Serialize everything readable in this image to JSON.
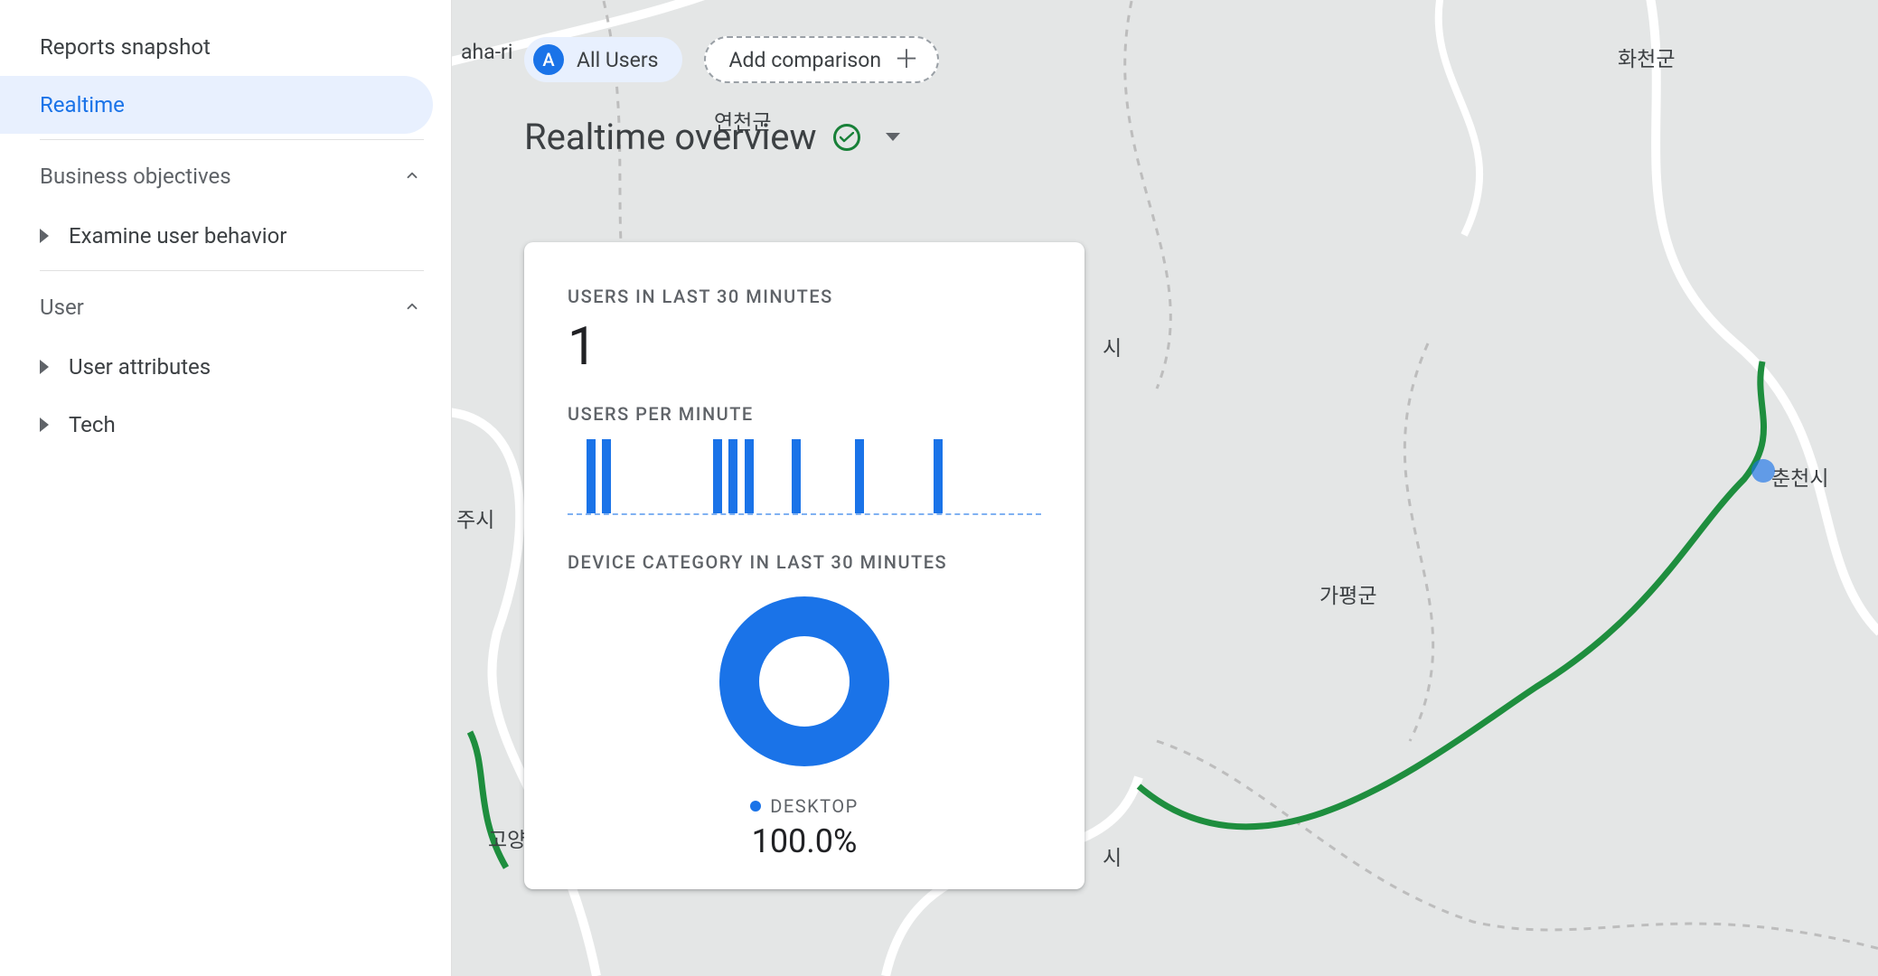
{
  "sidebar": {
    "reports_snapshot": "Reports snapshot",
    "realtime": "Realtime",
    "business_objectives": "Business objectives",
    "examine_user_behavior": "Examine user behavior",
    "user": "User",
    "user_attributes": "User attributes",
    "tech": "Tech"
  },
  "topbar": {
    "chip_letter": "A",
    "chip_label": "All Users",
    "add_comparison": "Add comparison"
  },
  "title": "Realtime overview",
  "map": {
    "labels": {
      "aha_ri": "aha-ri",
      "yeoncheon": "연천군",
      "si1": "시",
      "jusi": "주시",
      "goyang": "고양",
      "si2": "시",
      "gapyeong": "가평군",
      "hwacheon": "화천군",
      "chuncheon": "춘천시"
    }
  },
  "card": {
    "users_title": "USERS IN LAST 30 MINUTES",
    "users_value": "1",
    "upm_title": "USERS PER MINUTE",
    "device_title": "DEVICE CATEGORY IN LAST 30 MINUTES",
    "legend_label": "DESKTOP",
    "legend_pct": "100.0%"
  },
  "chart_data": {
    "type": "bar",
    "series_name": "Users per minute",
    "x_range_minutes": 30,
    "ylim": [
      0,
      1
    ],
    "values": [
      0,
      1,
      1,
      0,
      0,
      0,
      0,
      0,
      0,
      1,
      1,
      1,
      0,
      0,
      1,
      0,
      0,
      0,
      1,
      0,
      0,
      0,
      0,
      1,
      0,
      0,
      0,
      0,
      0,
      0
    ],
    "device_category": [
      {
        "name": "Desktop",
        "value": 100.0
      }
    ]
  },
  "colors": {
    "primary": "#1a73e8",
    "green": "#188038",
    "text": "#3c4043",
    "muted": "#5f6368"
  }
}
